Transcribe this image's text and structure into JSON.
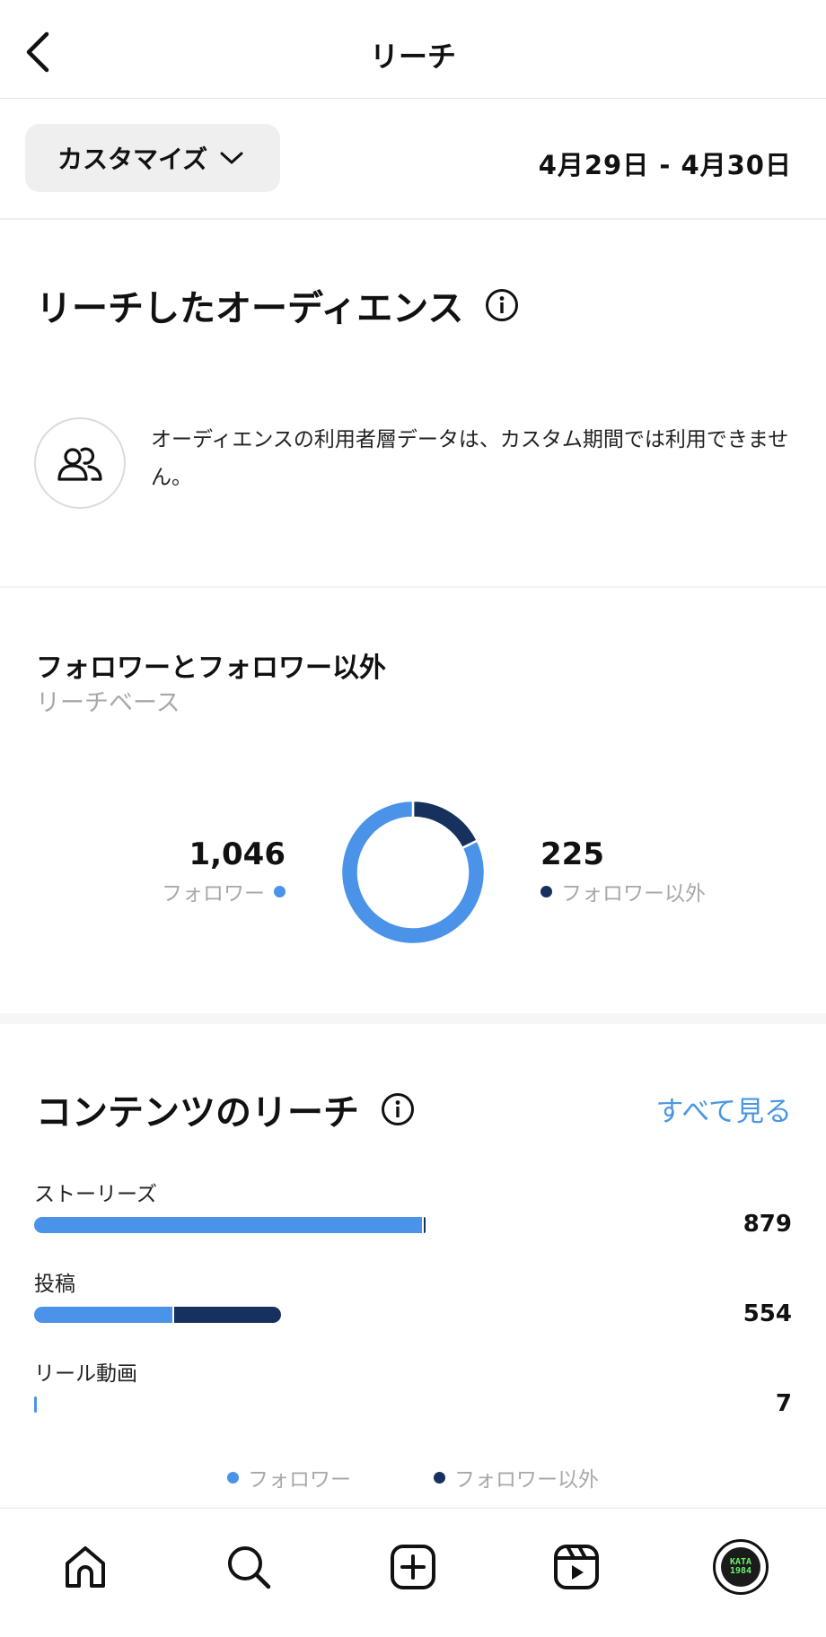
{
  "header": {
    "title": "リーチ"
  },
  "filter": {
    "customize_label": "カスタマイズ",
    "date_range": "4月29日 - 4月30日"
  },
  "audience": {
    "title": "リーチしたオーディエンス",
    "note": "オーディエンスの利用者層データは、カスタム期間では利用できません。"
  },
  "followers_section": {
    "title": "フォロワーとフォロワー以外",
    "subtitle": "リーチベース",
    "followers_value": "1,046",
    "followers_label": "フォロワー",
    "non_followers_value": "225",
    "non_followers_label": "フォロワー以外"
  },
  "content_reach": {
    "title": "コンテンツのリーチ",
    "see_all": "すべて見る",
    "rows": [
      {
        "label": "ストーリーズ",
        "value": "879",
        "total": 879,
        "followers_fraction": 0.99
      },
      {
        "label": "投稿",
        "value": "554",
        "total": 554,
        "followers_fraction": 0.56
      },
      {
        "label": "リール動画",
        "value": "7",
        "total": 7,
        "followers_fraction": 1.0
      }
    ],
    "legend_followers": "フォロワー",
    "legend_non_followers": "フォロワー以外"
  },
  "colors": {
    "followers": "#4a93e8",
    "non_followers": "#17315f",
    "link": "#4a97e3"
  },
  "chart_data": {
    "type": "pie",
    "categories": [
      "フォロワー",
      "フォロワー以外"
    ],
    "values": [
      1046,
      225
    ]
  },
  "bottom_nav": {
    "items": [
      "home-icon",
      "search-icon",
      "create-icon",
      "reels-icon",
      "profile-avatar"
    ]
  },
  "profile": {
    "avatar_text_1": "KATA",
    "avatar_text_2": "1984"
  }
}
